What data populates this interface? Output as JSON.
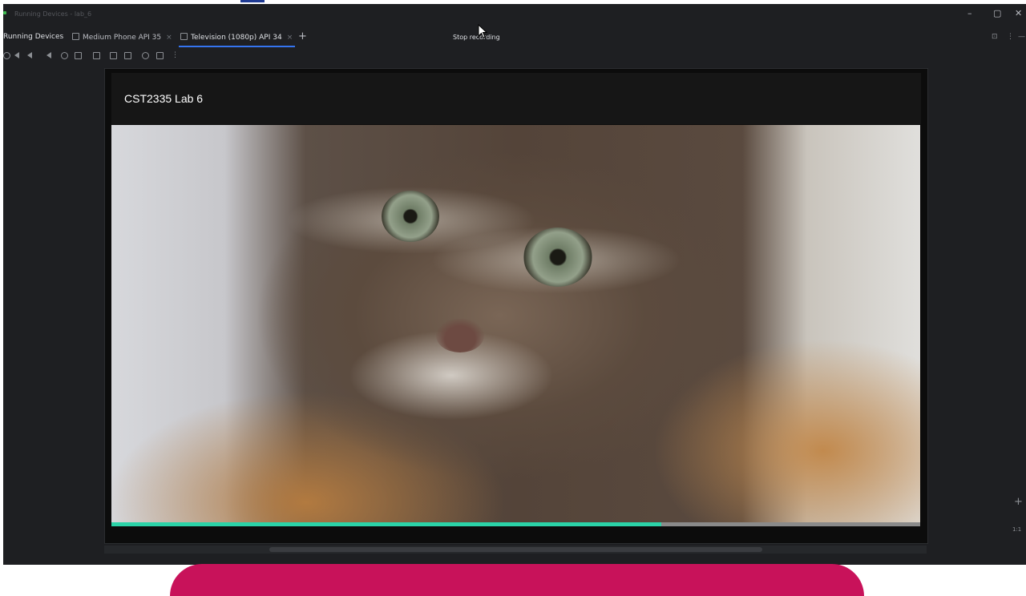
{
  "window": {
    "title": "Running Devices - lab_6",
    "minimize": "–",
    "maximize": "▢",
    "close": "✕"
  },
  "panel": {
    "title": "Running Devices"
  },
  "tabs": [
    {
      "label": "Medium Phone API 35",
      "close": "×"
    },
    {
      "label": "Television (1080p) API 34",
      "close": "×"
    }
  ],
  "tab_add": "+",
  "tooltip": "Stop recording",
  "app": {
    "title": "CST2335 Lab 6"
  },
  "video": {
    "progress_fraction": 0.68
  },
  "side_controls": {
    "zoom_in": "+",
    "ratio": "1:1"
  },
  "colors": {
    "accent": "#3574f0",
    "progress": "#2bd3a8",
    "pill": "#c8125a"
  }
}
